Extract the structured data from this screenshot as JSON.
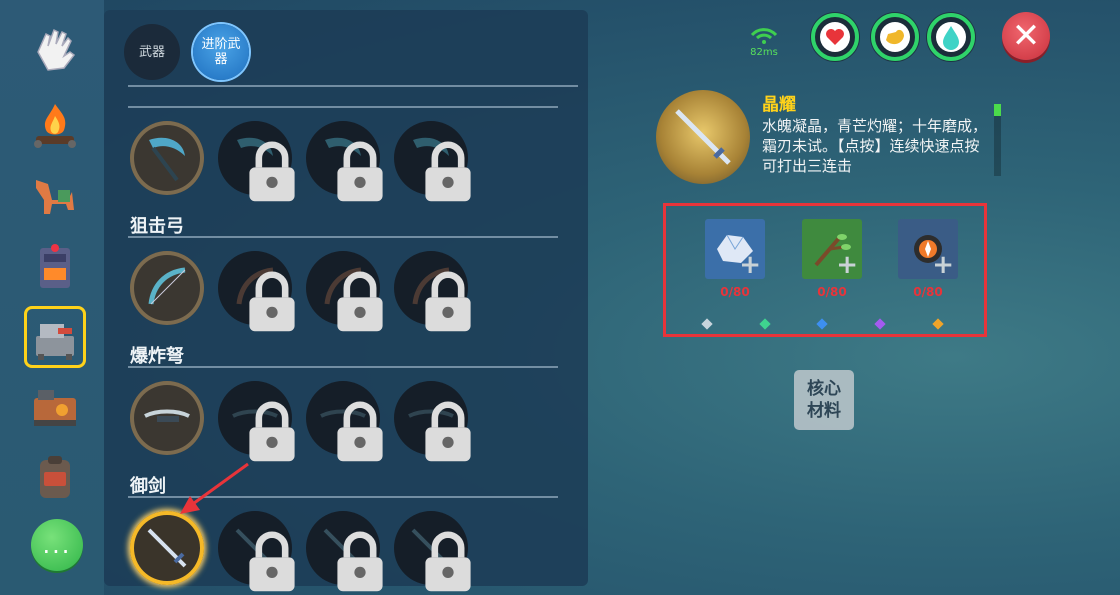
{
  "tabs": [
    {
      "label": "武器",
      "active": false
    },
    {
      "label": "进阶武器",
      "active": true
    }
  ],
  "sections": [
    {
      "title": "",
      "slots": [
        "owned",
        "locked",
        "locked",
        "locked"
      ]
    },
    {
      "title": "狙击弓",
      "slots": [
        "owned",
        "locked",
        "locked",
        "locked"
      ]
    },
    {
      "title": "爆炸弩",
      "slots": [
        "owned",
        "locked",
        "locked",
        "locked"
      ]
    },
    {
      "title": "御剑",
      "slots": [
        "selected",
        "locked",
        "locked",
        "locked"
      ]
    }
  ],
  "left_nav": [
    {
      "name": "hand-icon"
    },
    {
      "name": "campfire-icon"
    },
    {
      "name": "mount-icon"
    },
    {
      "name": "furnace-icon"
    },
    {
      "name": "workbench-icon",
      "selected": true
    },
    {
      "name": "machine-icon"
    },
    {
      "name": "backpack-icon"
    }
  ],
  "more_label": "...",
  "hud": {
    "ping": "82ms",
    "stats": [
      {
        "name": "health-icon",
        "color": "#e8343a"
      },
      {
        "name": "hunger-icon",
        "color": "#f0b72a"
      },
      {
        "name": "water-icon",
        "color": "#3fd3c6"
      }
    ],
    "close_label": "✕"
  },
  "item": {
    "name": "晶耀",
    "description": "水魄凝晶，青芒灼耀；十年磨成，霜刃未试。【点按】连续快速点按可打出三连击"
  },
  "materials": [
    {
      "name": "crystal-material-icon",
      "count": "0/80",
      "bg": "#3b6fa9"
    },
    {
      "name": "branch-material-icon",
      "count": "0/80",
      "bg": "#3f8a3e"
    },
    {
      "name": "core-material-icon",
      "count": "0/80",
      "bg": "#3a5c86"
    }
  ],
  "gem_colors": [
    "#c8d4dc",
    "#3fd38f",
    "#3d8ff0",
    "#a45bf0",
    "#f0a42a"
  ],
  "core_button": "核心材料"
}
